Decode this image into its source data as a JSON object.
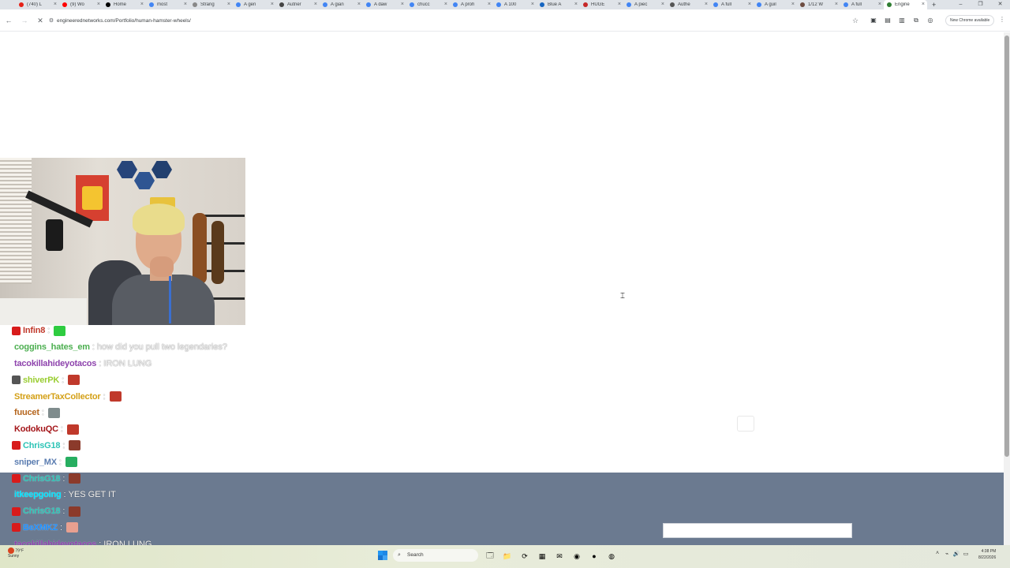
{
  "tabs": [
    {
      "label": "(740) L",
      "color": "#e62117"
    },
    {
      "label": "(9) Wo",
      "color": "#ff0000"
    },
    {
      "label": "Home",
      "color": "#000000"
    },
    {
      "label": "most",
      "color": "#4285f4"
    },
    {
      "label": "Strang",
      "color": "#888888"
    },
    {
      "label": "A gen",
      "color": "#4285f4"
    },
    {
      "label": "Autner",
      "color": "#444444"
    },
    {
      "label": "A gian",
      "color": "#4285f4"
    },
    {
      "label": "A daw",
      "color": "#4285f4"
    },
    {
      "label": "chucc",
      "color": "#4285f4"
    },
    {
      "label": "A proh",
      "color": "#4285f4"
    },
    {
      "label": "A 100",
      "color": "#4285f4"
    },
    {
      "label": "Blue A",
      "color": "#1565c0"
    },
    {
      "label": "HUGE",
      "color": "#c62828"
    },
    {
      "label": "A piec",
      "color": "#4285f4"
    },
    {
      "label": "Authe",
      "color": "#555555"
    },
    {
      "label": "A full",
      "color": "#4285f4"
    },
    {
      "label": "A guil",
      "color": "#4285f4"
    },
    {
      "label": "1/12 W",
      "color": "#6d4c41"
    },
    {
      "label": "A full",
      "color": "#4285f4"
    },
    {
      "label": "Engine",
      "color": "#2e7d32",
      "active": true
    }
  ],
  "new_tab": "+",
  "window": {
    "minimize": "–",
    "restore": "❐",
    "close": "✕"
  },
  "toolbar": {
    "back": "←",
    "forward": "→",
    "stop": "✕",
    "url": "engineerednetworks.com/Portfolio/human-hamster-wheels/",
    "star": "☆",
    "update_chip": "New Chrome available",
    "menu": "⋮"
  },
  "chat": {
    "messages": [
      {
        "user": "Infin8",
        "user_color": "#c0392b",
        "badge": "#d81b1b",
        "text": "",
        "emote": "#2ecc40"
      },
      {
        "user": "coggins_hates_em",
        "user_color": "#4caf50",
        "badge": null,
        "text": "how did you pull two legendaries?",
        "emote": null
      },
      {
        "user": "tacokillahideyotacos",
        "user_color": "#8e44ad",
        "badge": null,
        "text": "IRON LUNG",
        "emote": null
      },
      {
        "user": "shiverPK",
        "user_color": "#9acd32",
        "badge": "#555555",
        "text": "",
        "emote": "#c0392b"
      },
      {
        "user": "StreamerTaxCollector",
        "user_color": "#d4a017",
        "badge": null,
        "text": "",
        "emote": "#c0392b"
      },
      {
        "user": "fuucet",
        "user_color": "#b5651d",
        "badge": null,
        "text": "",
        "emote": "#7f8c8d"
      },
      {
        "user": "KodokuQC",
        "user_color": "#a4161a",
        "badge": null,
        "text": "",
        "emote": "#c0392b"
      },
      {
        "user": "ChrisG18",
        "user_color": "#2ec4b6",
        "badge": "#d81b1b",
        "text": "",
        "emote": "#8b3a2b"
      },
      {
        "user": "sniper_MX",
        "user_color": "#5b7db1",
        "badge": null,
        "text": "",
        "emote": "#27ae60"
      },
      {
        "user": "ChrisG18",
        "user_color": "#2ec4b6",
        "badge": "#d81b1b",
        "text": "",
        "emote": "#8b3a2b"
      },
      {
        "user": "itkeepgoing",
        "user_color": "#00e5ff",
        "badge": null,
        "text": "YES GET IT",
        "emote": null
      },
      {
        "user": "ChrisG18",
        "user_color": "#2ec4b6",
        "badge": "#d81b1b",
        "text": "",
        "emote": "#8b3a2b"
      },
      {
        "user": "BeXMKZ",
        "user_color": "#1e90ff",
        "badge": "#d81b1b",
        "text": "",
        "emote": "#e8a090"
      },
      {
        "user": "tacokillahideyotacos",
        "user_color": "#8e44ad",
        "badge": null,
        "text": "IRON LUNG",
        "emote": null
      }
    ],
    "separator": ":"
  },
  "taskbar": {
    "weather_temp": "79°F",
    "weather_desc": "Sunny",
    "search_label": "Search",
    "apps": [
      "🗔",
      "📁",
      "⟳",
      "▦",
      "✉",
      "◉",
      "●",
      "◍"
    ],
    "tray": [
      "˄",
      "⌁",
      "🔊",
      "▭"
    ],
    "time": "4:38 PM",
    "date": "8/22/2026"
  }
}
